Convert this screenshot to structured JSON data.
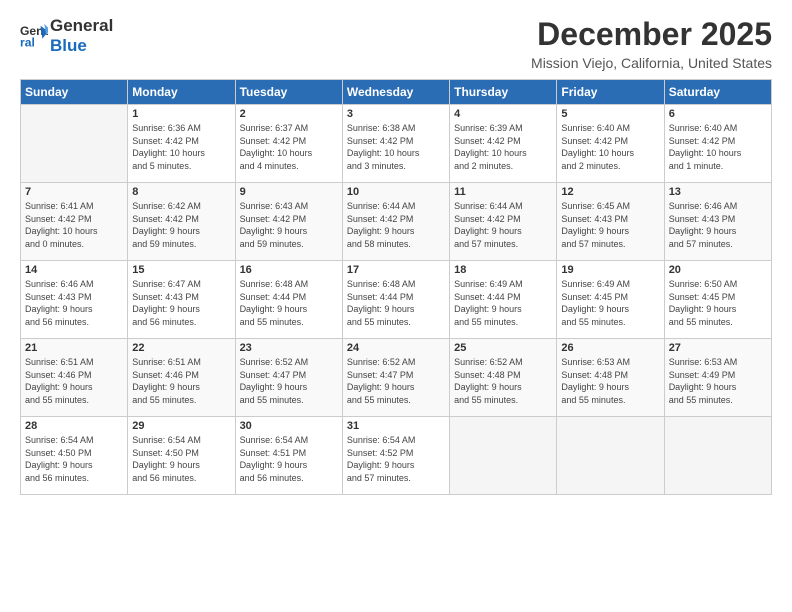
{
  "logo": {
    "line1": "General",
    "line2": "Blue"
  },
  "header": {
    "title": "December 2025",
    "subtitle": "Mission Viejo, California, United States"
  },
  "weekdays": [
    "Sunday",
    "Monday",
    "Tuesday",
    "Wednesday",
    "Thursday",
    "Friday",
    "Saturday"
  ],
  "weeks": [
    [
      {
        "day": "",
        "info": ""
      },
      {
        "day": "1",
        "info": "Sunrise: 6:36 AM\nSunset: 4:42 PM\nDaylight: 10 hours\nand 5 minutes."
      },
      {
        "day": "2",
        "info": "Sunrise: 6:37 AM\nSunset: 4:42 PM\nDaylight: 10 hours\nand 4 minutes."
      },
      {
        "day": "3",
        "info": "Sunrise: 6:38 AM\nSunset: 4:42 PM\nDaylight: 10 hours\nand 3 minutes."
      },
      {
        "day": "4",
        "info": "Sunrise: 6:39 AM\nSunset: 4:42 PM\nDaylight: 10 hours\nand 2 minutes."
      },
      {
        "day": "5",
        "info": "Sunrise: 6:40 AM\nSunset: 4:42 PM\nDaylight: 10 hours\nand 2 minutes."
      },
      {
        "day": "6",
        "info": "Sunrise: 6:40 AM\nSunset: 4:42 PM\nDaylight: 10 hours\nand 1 minute."
      }
    ],
    [
      {
        "day": "7",
        "info": "Sunrise: 6:41 AM\nSunset: 4:42 PM\nDaylight: 10 hours\nand 0 minutes."
      },
      {
        "day": "8",
        "info": "Sunrise: 6:42 AM\nSunset: 4:42 PM\nDaylight: 9 hours\nand 59 minutes."
      },
      {
        "day": "9",
        "info": "Sunrise: 6:43 AM\nSunset: 4:42 PM\nDaylight: 9 hours\nand 59 minutes."
      },
      {
        "day": "10",
        "info": "Sunrise: 6:44 AM\nSunset: 4:42 PM\nDaylight: 9 hours\nand 58 minutes."
      },
      {
        "day": "11",
        "info": "Sunrise: 6:44 AM\nSunset: 4:42 PM\nDaylight: 9 hours\nand 57 minutes."
      },
      {
        "day": "12",
        "info": "Sunrise: 6:45 AM\nSunset: 4:43 PM\nDaylight: 9 hours\nand 57 minutes."
      },
      {
        "day": "13",
        "info": "Sunrise: 6:46 AM\nSunset: 4:43 PM\nDaylight: 9 hours\nand 57 minutes."
      }
    ],
    [
      {
        "day": "14",
        "info": "Sunrise: 6:46 AM\nSunset: 4:43 PM\nDaylight: 9 hours\nand 56 minutes."
      },
      {
        "day": "15",
        "info": "Sunrise: 6:47 AM\nSunset: 4:43 PM\nDaylight: 9 hours\nand 56 minutes."
      },
      {
        "day": "16",
        "info": "Sunrise: 6:48 AM\nSunset: 4:44 PM\nDaylight: 9 hours\nand 55 minutes."
      },
      {
        "day": "17",
        "info": "Sunrise: 6:48 AM\nSunset: 4:44 PM\nDaylight: 9 hours\nand 55 minutes."
      },
      {
        "day": "18",
        "info": "Sunrise: 6:49 AM\nSunset: 4:44 PM\nDaylight: 9 hours\nand 55 minutes."
      },
      {
        "day": "19",
        "info": "Sunrise: 6:49 AM\nSunset: 4:45 PM\nDaylight: 9 hours\nand 55 minutes."
      },
      {
        "day": "20",
        "info": "Sunrise: 6:50 AM\nSunset: 4:45 PM\nDaylight: 9 hours\nand 55 minutes."
      }
    ],
    [
      {
        "day": "21",
        "info": "Sunrise: 6:51 AM\nSunset: 4:46 PM\nDaylight: 9 hours\nand 55 minutes."
      },
      {
        "day": "22",
        "info": "Sunrise: 6:51 AM\nSunset: 4:46 PM\nDaylight: 9 hours\nand 55 minutes."
      },
      {
        "day": "23",
        "info": "Sunrise: 6:52 AM\nSunset: 4:47 PM\nDaylight: 9 hours\nand 55 minutes."
      },
      {
        "day": "24",
        "info": "Sunrise: 6:52 AM\nSunset: 4:47 PM\nDaylight: 9 hours\nand 55 minutes."
      },
      {
        "day": "25",
        "info": "Sunrise: 6:52 AM\nSunset: 4:48 PM\nDaylight: 9 hours\nand 55 minutes."
      },
      {
        "day": "26",
        "info": "Sunrise: 6:53 AM\nSunset: 4:48 PM\nDaylight: 9 hours\nand 55 minutes."
      },
      {
        "day": "27",
        "info": "Sunrise: 6:53 AM\nSunset: 4:49 PM\nDaylight: 9 hours\nand 55 minutes."
      }
    ],
    [
      {
        "day": "28",
        "info": "Sunrise: 6:54 AM\nSunset: 4:50 PM\nDaylight: 9 hours\nand 56 minutes."
      },
      {
        "day": "29",
        "info": "Sunrise: 6:54 AM\nSunset: 4:50 PM\nDaylight: 9 hours\nand 56 minutes."
      },
      {
        "day": "30",
        "info": "Sunrise: 6:54 AM\nSunset: 4:51 PM\nDaylight: 9 hours\nand 56 minutes."
      },
      {
        "day": "31",
        "info": "Sunrise: 6:54 AM\nSunset: 4:52 PM\nDaylight: 9 hours\nand 57 minutes."
      },
      {
        "day": "",
        "info": ""
      },
      {
        "day": "",
        "info": ""
      },
      {
        "day": "",
        "info": ""
      }
    ]
  ]
}
